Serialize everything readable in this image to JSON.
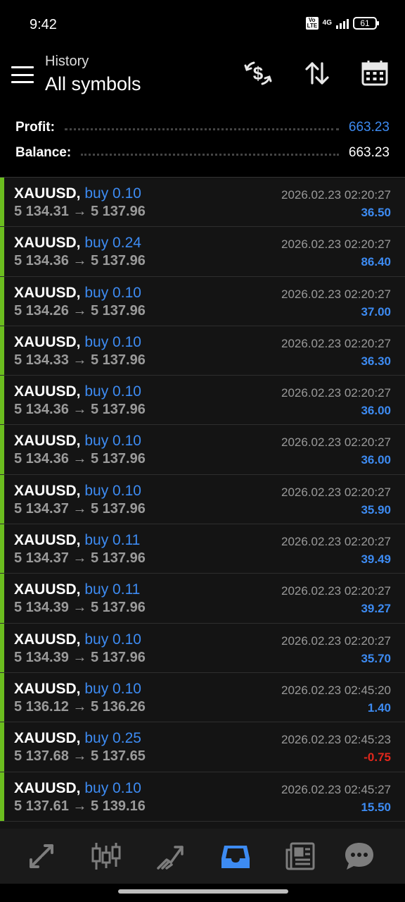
{
  "status_bar": {
    "time": "9:42",
    "network_badge": "Vo LTE",
    "network_type": "4G",
    "battery": "61"
  },
  "header": {
    "subtitle": "History",
    "title": "All symbols"
  },
  "summary": {
    "profit_label": "Profit:",
    "profit_value": "663.23",
    "balance_label": "Balance:",
    "balance_value": "663.23"
  },
  "deals": [
    {
      "symbol": "XAUUSD,",
      "direction": "buy 0.10",
      "prices": "5 134.31 → 5 137.96",
      "time": "2026.02.23 02:20:27",
      "profit": "36.50"
    },
    {
      "symbol": "XAUUSD,",
      "direction": "buy 0.24",
      "prices": "5 134.36 → 5 137.96",
      "time": "2026.02.23 02:20:27",
      "profit": "86.40"
    },
    {
      "symbol": "XAUUSD,",
      "direction": "buy 0.10",
      "prices": "5 134.26 → 5 137.96",
      "time": "2026.02.23 02:20:27",
      "profit": "37.00"
    },
    {
      "symbol": "XAUUSD,",
      "direction": "buy 0.10",
      "prices": "5 134.33 → 5 137.96",
      "time": "2026.02.23 02:20:27",
      "profit": "36.30"
    },
    {
      "symbol": "XAUUSD,",
      "direction": "buy 0.10",
      "prices": "5 134.36 → 5 137.96",
      "time": "2026.02.23 02:20:27",
      "profit": "36.00"
    },
    {
      "symbol": "XAUUSD,",
      "direction": "buy 0.10",
      "prices": "5 134.36 → 5 137.96",
      "time": "2026.02.23 02:20:27",
      "profit": "36.00"
    },
    {
      "symbol": "XAUUSD,",
      "direction": "buy 0.10",
      "prices": "5 134.37 → 5 137.96",
      "time": "2026.02.23 02:20:27",
      "profit": "35.90"
    },
    {
      "symbol": "XAUUSD,",
      "direction": "buy 0.11",
      "prices": "5 134.37 → 5 137.96",
      "time": "2026.02.23 02:20:27",
      "profit": "39.49"
    },
    {
      "symbol": "XAUUSD,",
      "direction": "buy 0.11",
      "prices": "5 134.39 → 5 137.96",
      "time": "2026.02.23 02:20:27",
      "profit": "39.27"
    },
    {
      "symbol": "XAUUSD,",
      "direction": "buy 0.10",
      "prices": "5 134.39 → 5 137.96",
      "time": "2026.02.23 02:20:27",
      "profit": "35.70"
    },
    {
      "symbol": "XAUUSD,",
      "direction": "buy 0.10",
      "prices": "5 136.12 → 5 136.26",
      "time": "2026.02.23 02:45:20",
      "profit": "1.40"
    },
    {
      "symbol": "XAUUSD,",
      "direction": "buy 0.25",
      "prices": "5 137.68 → 5 137.65",
      "time": "2026.02.23 02:45:23",
      "profit": "-0.75"
    },
    {
      "symbol": "XAUUSD,",
      "direction": "buy 0.10",
      "prices": "5 137.61 → 5 139.16",
      "time": "2026.02.23 02:45:27",
      "profit": "15.50"
    }
  ],
  "icons": {
    "header": [
      "currency-exchange-icon",
      "sort-icon",
      "calendar-icon"
    ],
    "bottom_nav": [
      "quotes-icon",
      "chart-icon",
      "trade-icon",
      "history-icon",
      "news-icon",
      "chat-icon"
    ]
  },
  "colors": {
    "accent": "#3d8bf2",
    "negative": "#e0271c",
    "buy_marker": "#6bbd1f",
    "secondary_text": "#9a9a9a"
  },
  "bottom_nav": {
    "active_index": 3
  }
}
